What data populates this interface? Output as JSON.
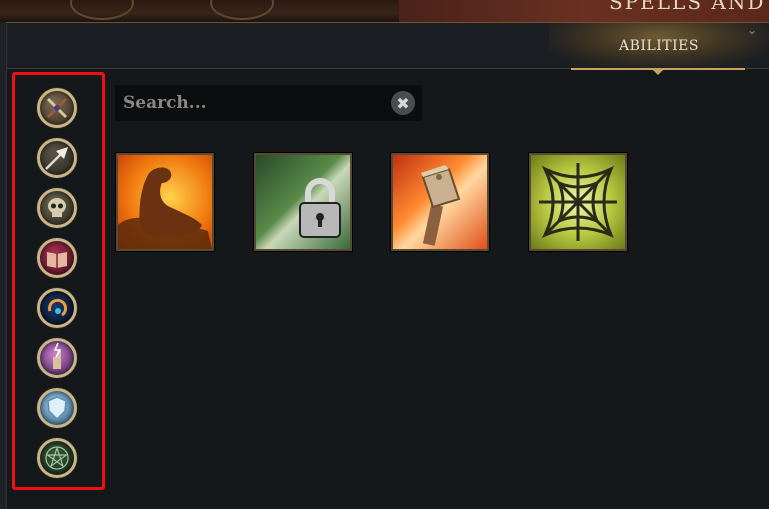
{
  "header": {
    "banner_title": "SPELLS AND A",
    "active_tab_label": "ABILITIES"
  },
  "sidebar": {
    "categories": [
      {
        "icon": "crossed-weapons-icon"
      },
      {
        "icon": "arrow-icon"
      },
      {
        "icon": "skull-icon"
      },
      {
        "icon": "spellbook-icon"
      },
      {
        "icon": "swirl-orb-icon"
      },
      {
        "icon": "lightning-hand-icon"
      },
      {
        "icon": "shield-icon"
      },
      {
        "icon": "pentagram-icon"
      }
    ]
  },
  "search": {
    "placeholder": "Search...",
    "value": "",
    "clear_icon": "close-icon"
  },
  "abilities": [
    {
      "icon": "flexed-arm-icon"
    },
    {
      "icon": "padlock-icon"
    },
    {
      "icon": "hammer-icon"
    },
    {
      "icon": "spider-web-icon"
    }
  ],
  "colors": {
    "highlight_border": "#f01010",
    "gold_accent": "#c9a45a"
  }
}
